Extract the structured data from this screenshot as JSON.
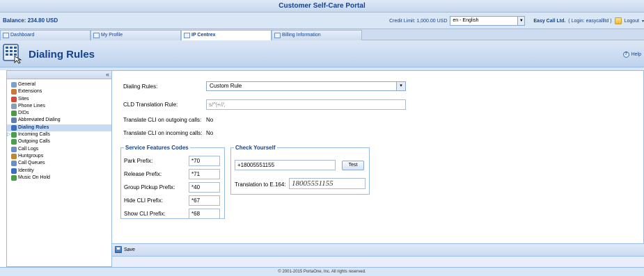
{
  "app": {
    "title": "Customer Self-Care Portal"
  },
  "info": {
    "balance": "Balance: 234.80 USD",
    "credit_limit": "Credit Limit: 1,000.00 USD",
    "language": "en - English",
    "company": "Easy Call Ltd.",
    "login": "( Login: easycallltd )",
    "logout": "Logout"
  },
  "tabs": [
    {
      "label": "Dashboard"
    },
    {
      "label": "My Profile"
    },
    {
      "label": "IP Centrex"
    },
    {
      "label": "Billing Information"
    }
  ],
  "header": {
    "title": "Dialing Rules",
    "help": "Help"
  },
  "sidebar": {
    "collapse": "«",
    "items": [
      {
        "label": "General",
        "color": "#7fa0c8"
      },
      {
        "label": "Extensions",
        "color": "#c87a3a"
      },
      {
        "label": "Sites",
        "color": "#d24a3a"
      },
      {
        "label": "Phone Lines",
        "color": "#8aa0b8"
      },
      {
        "label": "DIDs",
        "color": "#4a9a4a"
      },
      {
        "label": "Abbreviated Dialing",
        "color": "#5f7fae"
      },
      {
        "label": "Dialing Rules",
        "color": "#3a6fc0"
      },
      {
        "label": "Incoming Calls",
        "color": "#4aa04a"
      },
      {
        "label": "Outgoing Calls",
        "color": "#4aa04a"
      },
      {
        "label": "Call Logs",
        "color": "#6b8fc2"
      },
      {
        "label": "Huntgroups",
        "color": "#c0882f"
      },
      {
        "label": "Call Queues",
        "color": "#6b8fc2"
      },
      {
        "label": "Identity",
        "color": "#3a6fc0"
      },
      {
        "label": "Music On Hold",
        "color": "#4aa04a"
      }
    ]
  },
  "form": {
    "dialing_rules_label": "Dialing Rules:",
    "dialing_rules_value": "Custom Rule",
    "cld_label": "CLD Translation Rule:",
    "cld_placeholder": "s/^|+//;",
    "cli_out_label": "Translate CLI on outgoing calls:",
    "cli_out_value": "No",
    "cli_in_label": "Translate CLI on incoming calls:",
    "cli_in_value": "No"
  },
  "service_codes": {
    "legend": "Service Features Codes",
    "rows": [
      {
        "label": "Park Prefix:",
        "value": "*70"
      },
      {
        "label": "Release Prefix:",
        "value": "*71"
      },
      {
        "label": "Group Pickup Prefix:",
        "value": "*40"
      },
      {
        "label": "Hide CLI Prefix:",
        "value": "*67"
      },
      {
        "label": "Show CLI Prefix:",
        "value": "*68"
      }
    ]
  },
  "check": {
    "legend": "Check Yourself",
    "number": "+18005551155",
    "test_button": "Test",
    "translation_label": "Translation to E.164:",
    "translation_value": "18005551155"
  },
  "actions": {
    "save": "Save"
  },
  "footer": "© 2001-2015 PortaOne, Inc. All rights reserved."
}
